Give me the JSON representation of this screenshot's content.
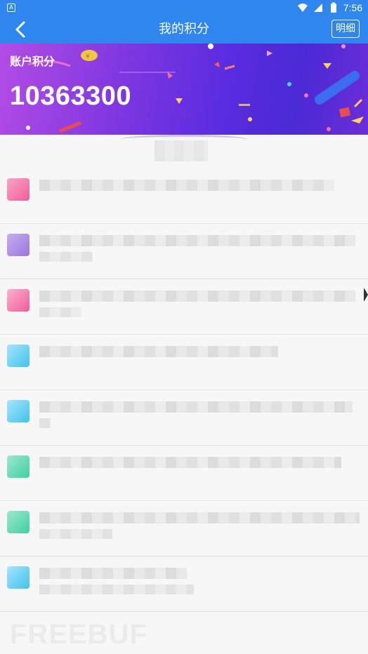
{
  "status_bar": {
    "time": "7:56",
    "left_icon": "A",
    "icons": [
      "wifi-icon",
      "signal-icon",
      "battery-icon"
    ]
  },
  "app_bar": {
    "title": "我的积分",
    "detail_button": "明细",
    "back_icon": "chevron-left-icon"
  },
  "banner": {
    "label": "账户积分",
    "points": "10363300"
  },
  "watermark": "FREEBUF",
  "colors": {
    "primary": "#2f86ee",
    "banner_start": "#b44ce6",
    "banner_end": "#4b2ad6",
    "icon_pink": "#f25a9a",
    "icon_purple": "#9b73dc",
    "icon_cyan": "#40c2ef",
    "icon_teal": "#3fcfa4"
  }
}
